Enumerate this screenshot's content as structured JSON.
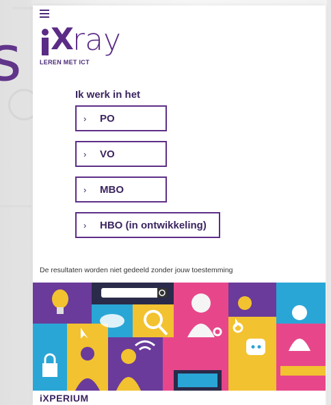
{
  "brand": {
    "logo_main": "X",
    "logo_suffix": "ray",
    "logo_tagline": "LEREN MET ICT",
    "footer_brand": "iXPERIUM",
    "background_glyph": "s"
  },
  "menu": {
    "icon": "hamburger-icon"
  },
  "selector": {
    "heading": "Ik werk in het",
    "options": [
      {
        "label": "PO",
        "icon": "chevron-right-icon"
      },
      {
        "label": "VO",
        "icon": "chevron-right-icon"
      },
      {
        "label": "MBO",
        "icon": "chevron-right-icon"
      },
      {
        "label": "HBO (in ontwikkeling)",
        "icon": "chevron-right-icon"
      }
    ]
  },
  "privacy_note": "De resultaten worden niet gedeeld zonder jouw toestemming",
  "colors": {
    "accent": "#5b2c86",
    "text_dark": "#3b2460",
    "banner_purple": "#6a3b9a",
    "banner_yellow": "#f2c230",
    "banner_blue": "#2aa6d6",
    "banner_pink": "#e7478a"
  }
}
